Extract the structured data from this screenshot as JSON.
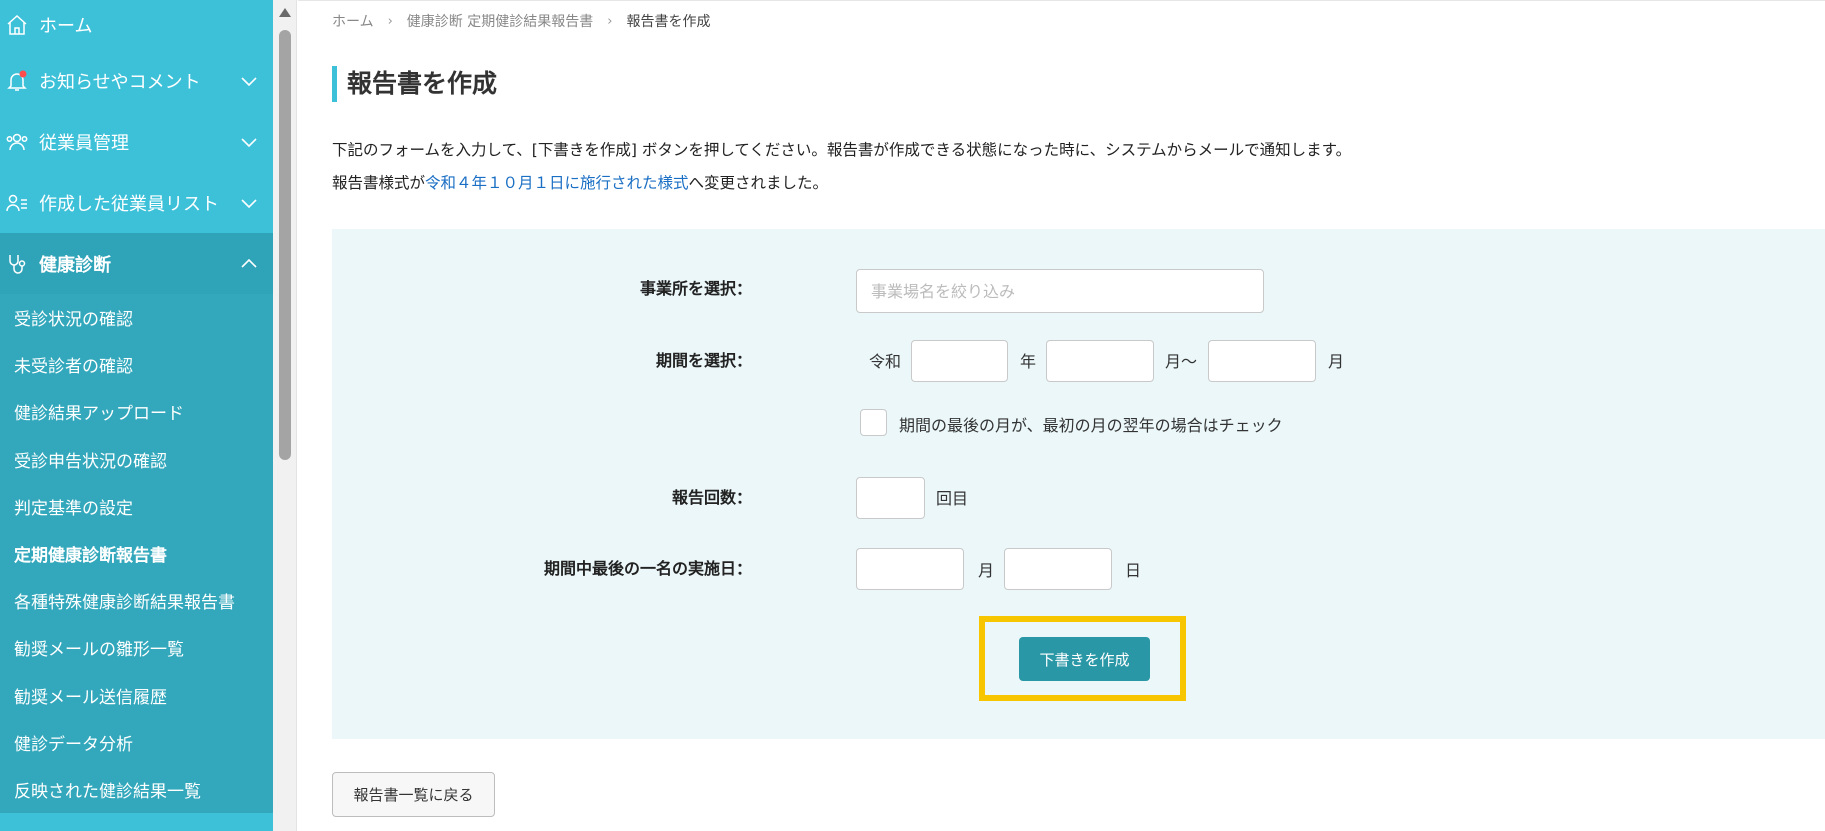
{
  "sidebar": {
    "items": [
      {
        "label": "ホーム",
        "icon": "home-icon"
      },
      {
        "label": "お知らせやコメント",
        "icon": "bell-icon",
        "badge_color": "#ff4d4d"
      },
      {
        "label": "従業員管理",
        "icon": "people-icon"
      },
      {
        "label": "作成した従業員リスト",
        "icon": "person-list-icon"
      },
      {
        "label": "健康診断",
        "icon": "stethoscope-icon"
      }
    ],
    "sub_items": [
      "受診状況の確認",
      "未受診者の確認",
      "健診結果アップロード",
      "受診申告状況の確認",
      "判定基準の設定",
      "定期健康診断報告書",
      "各種特殊健康診断結果報告書",
      "勧奨メールの雛形一覧",
      "勧奨メール送信履歴",
      "健診データ分析",
      "反映された健診結果一覧"
    ],
    "colors": {
      "background": "#3dc1d9",
      "active": "#2fa3b8",
      "sub_background": "#33a8bc"
    }
  },
  "breadcrumb": {
    "home": "ホーム",
    "parent": "健康診断 定期健診結果報告書",
    "current": "報告書を作成"
  },
  "page": {
    "title": "報告書を作成",
    "intro_line1": "下記のフォームを入力して、[下書きを作成] ボタンを押してください。報告書が作成できる状態になった時に、システムからメールで通知します。",
    "intro_line2_prefix": "報告書様式が",
    "intro_line2_link": "令和４年１０月１日に施行された様式",
    "intro_line2_suffix": "へ変更されました。"
  },
  "form": {
    "office_label": "事業所を選択：",
    "office_placeholder": "事業場名を絞り込み",
    "period_label": "期間を選択：",
    "era": "令和",
    "year_unit": "年",
    "month_from_unit": "月〜",
    "month_to_unit": "月",
    "next_year_checkbox_label": "期間の最後の月が、最初の月の翌年の場合はチェック",
    "report_count_label": "報告回数：",
    "report_count_unit": "回目",
    "last_exam_label": "期間中最後の一名の実施日：",
    "month_unit": "月",
    "day_unit": "日",
    "submit_label": "下書きを作成"
  },
  "back_button": "報告書一覧に戻る",
  "colors": {
    "accent": "#3dc1d9",
    "primary_button": "#2a97a6",
    "highlight": "#f7c600",
    "panel": "#ebf7f9",
    "link": "#1a6fc4"
  }
}
